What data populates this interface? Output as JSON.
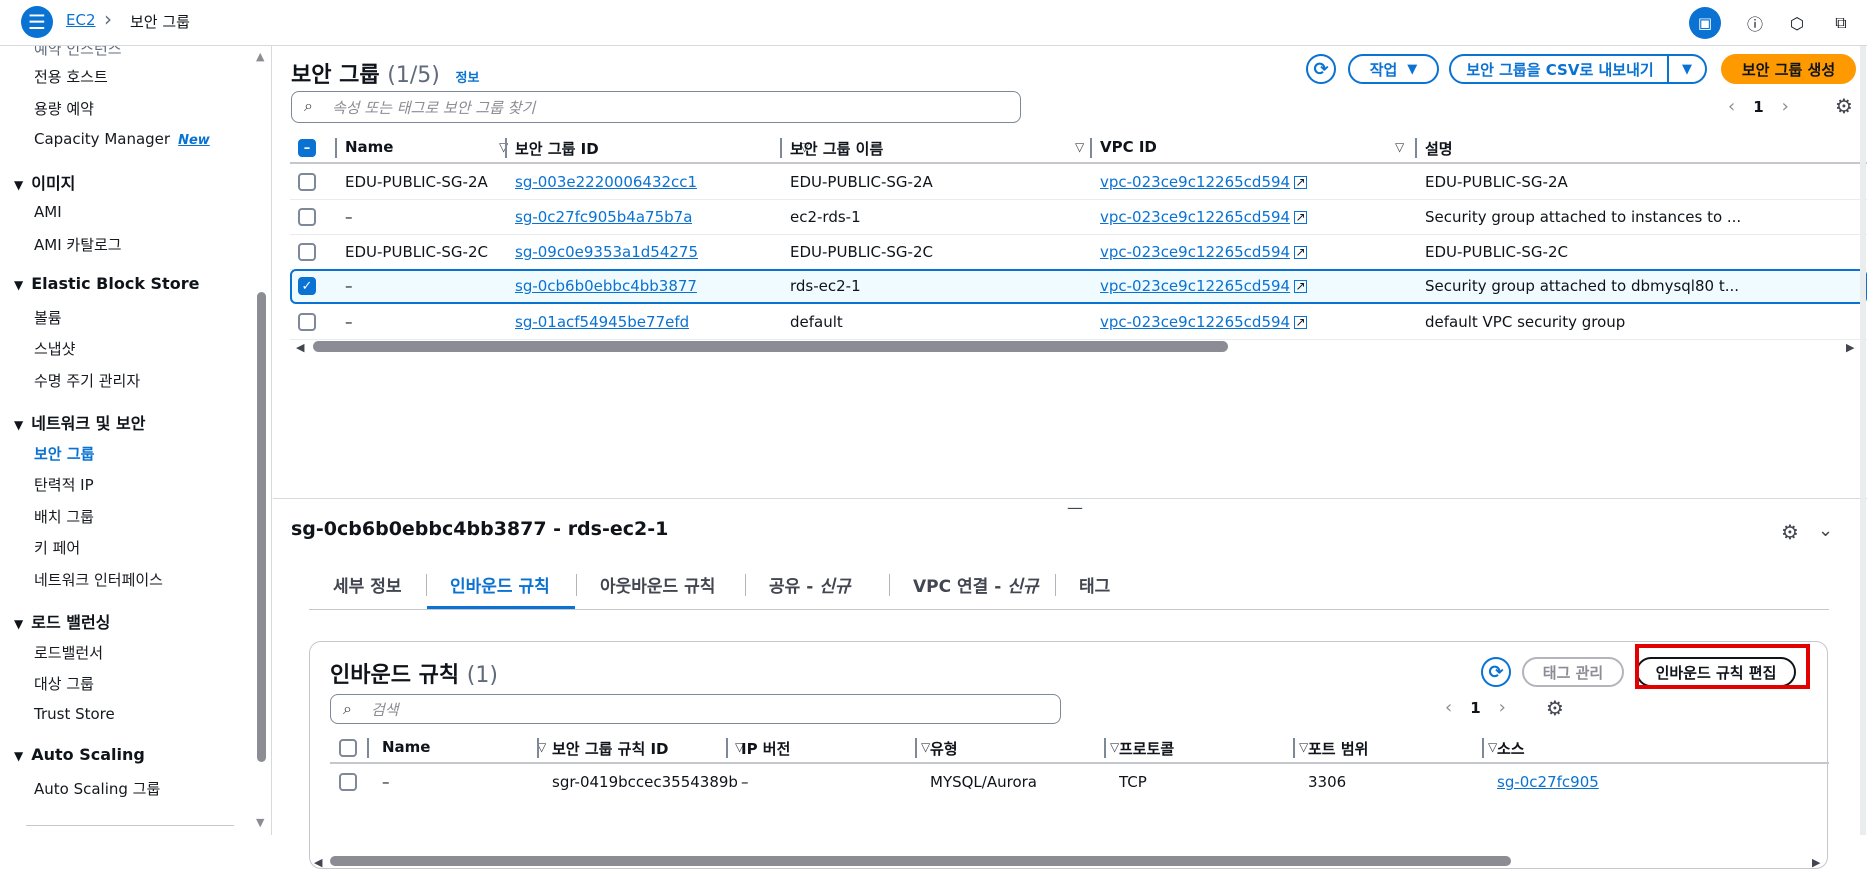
{
  "topbar": {
    "breadcrumb_root": "EC2",
    "breadcrumb_sep": "›",
    "breadcrumb_current": "보안 그룹"
  },
  "sidebar": {
    "cut_item": "예약 인스턴스",
    "items_top": [
      {
        "label": "전용 호스트"
      },
      {
        "label": "용량 예약"
      },
      {
        "label": "Capacity Manager",
        "badge": "New"
      }
    ],
    "sections": [
      {
        "title": "이미지",
        "items": [
          "AMI",
          "AMI 카탈로그"
        ]
      },
      {
        "title": "Elastic Block Store",
        "items": [
          "볼륨",
          "스냅샷",
          "수명 주기 관리자"
        ]
      },
      {
        "title": "네트워크 및 보안",
        "items": [
          "보안 그룹",
          "탄력적 IP",
          "배치 그룹",
          "키 페어",
          "네트워크 인터페이스"
        ]
      },
      {
        "title": "로드 밸런싱",
        "items": [
          "로드밸런서",
          "대상 그룹",
          "Trust Store"
        ]
      },
      {
        "title": "Auto Scaling",
        "items": [
          "Auto Scaling 그룹"
        ]
      }
    ],
    "active_item": "보안 그룹"
  },
  "sg_list": {
    "title": "보안 그룹",
    "count": "(1/5)",
    "info": "정보",
    "actions_label": "작업",
    "export_label": "보안 그룹을 CSV로 내보내기",
    "create_label": "보안 그룹 생성",
    "search_placeholder": "속성 또는 태그로 보안 그룹 찾기",
    "page": "1",
    "columns": [
      "Name",
      "보안 그룹 ID",
      "보안 그룹 이름",
      "VPC ID",
      "설명"
    ],
    "rows": [
      {
        "name": "EDU-PUBLIC-SG-2A",
        "id": "sg-003e2220006432cc1",
        "group_name": "EDU-PUBLIC-SG-2A",
        "vpc": "vpc-023ce9c12265cd594",
        "desc": "EDU-PUBLIC-SG-2A",
        "checked": false
      },
      {
        "name": "–",
        "id": "sg-0c27fc905b4a75b7a",
        "group_name": "ec2-rds-1",
        "vpc": "vpc-023ce9c12265cd594",
        "desc": "Security group attached to instances to ...",
        "checked": false
      },
      {
        "name": "EDU-PUBLIC-SG-2C",
        "id": "sg-09c0e9353a1d54275",
        "group_name": "EDU-PUBLIC-SG-2C",
        "vpc": "vpc-023ce9c12265cd594",
        "desc": "EDU-PUBLIC-SG-2C",
        "checked": false
      },
      {
        "name": "–",
        "id": "sg-0cb6b0ebbc4bb3877",
        "group_name": "rds-ec2-1",
        "vpc": "vpc-023ce9c12265cd594",
        "desc": "Security group attached to dbmysql80 t...",
        "checked": true
      },
      {
        "name": "–",
        "id": "sg-01acf54945be77efd",
        "group_name": "default",
        "vpc": "vpc-023ce9c12265cd594",
        "desc": "default VPC security group",
        "checked": false
      }
    ]
  },
  "detail": {
    "title": "sg-0cb6b0ebbc4bb3877 - rds-ec2-1",
    "tabs": [
      {
        "label": "세부 정보"
      },
      {
        "label": "인바운드 규칙"
      },
      {
        "label": "아웃바운드 규칙"
      },
      {
        "label": "공유 - ",
        "suffix": "신규"
      },
      {
        "label": "VPC 연결 - ",
        "suffix": "신규"
      },
      {
        "label": "태그"
      }
    ],
    "active_tab": "인바운드 규칙"
  },
  "inbound": {
    "title": "인바운드 규칙",
    "count": "(1)",
    "manage_tags_label": "태그 관리",
    "edit_label": "인바운드 규칙 편집",
    "search_placeholder": "검색",
    "page": "1",
    "columns": [
      "Name",
      "보안 그룹 규칙 ID",
      "IP 버전",
      "유형",
      "프로토콜",
      "포트 범위",
      "소스"
    ],
    "rows": [
      {
        "name": "–",
        "rule_id": "sgr-0419bccec3554389b",
        "ip_version": "–",
        "type": "MYSQL/Aurora",
        "protocol": "TCP",
        "port": "3306",
        "source": "sg-0c27fc905"
      }
    ]
  },
  "colors": {
    "accent": "#0972d3",
    "primary_button": "#ff9900",
    "highlight_box": "#e30000"
  }
}
